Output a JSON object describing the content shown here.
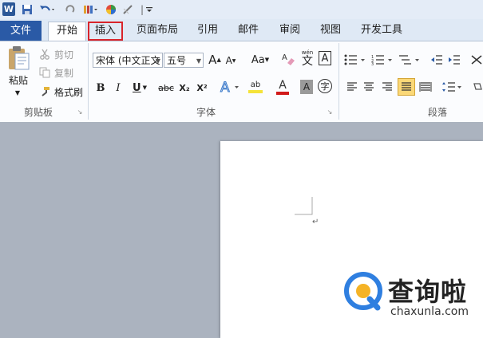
{
  "tabs": [
    {
      "label": "文件"
    },
    {
      "label": "开始"
    },
    {
      "label": "插入"
    },
    {
      "label": "页面布局"
    },
    {
      "label": "引用"
    },
    {
      "label": "邮件"
    },
    {
      "label": "审阅"
    },
    {
      "label": "视图"
    },
    {
      "label": "开发工具"
    }
  ],
  "clipboard": {
    "paste_label": "粘贴",
    "cut_label": "剪切",
    "copy_label": "复制",
    "format_painter_label": "格式刷",
    "group_label": "剪贴板"
  },
  "font": {
    "font_name": "宋体 (中文正文",
    "font_size": "五号",
    "group_label": "字体",
    "bold": "B",
    "italic": "I",
    "underline": "U",
    "strike": "abc",
    "subscript": "X₂",
    "superscript": "X²",
    "case": "Aa",
    "grow": "A",
    "shrink": "A",
    "phonetic_guide": "wén",
    "border_char": "A",
    "char_shading": "A",
    "enclose_char": "字",
    "font_color_glyph": "A",
    "highlight_glyph": "ab"
  },
  "paragraph": {
    "group_label": "段落"
  },
  "colors": {
    "accent": "#2a5aa6",
    "highlight_insert": "#d9242b",
    "font_color": "#d11a1a",
    "highlight_yellow": "#f5e33a"
  },
  "watermark": {
    "brand": "查询啦",
    "url": "chaxunla.com"
  }
}
